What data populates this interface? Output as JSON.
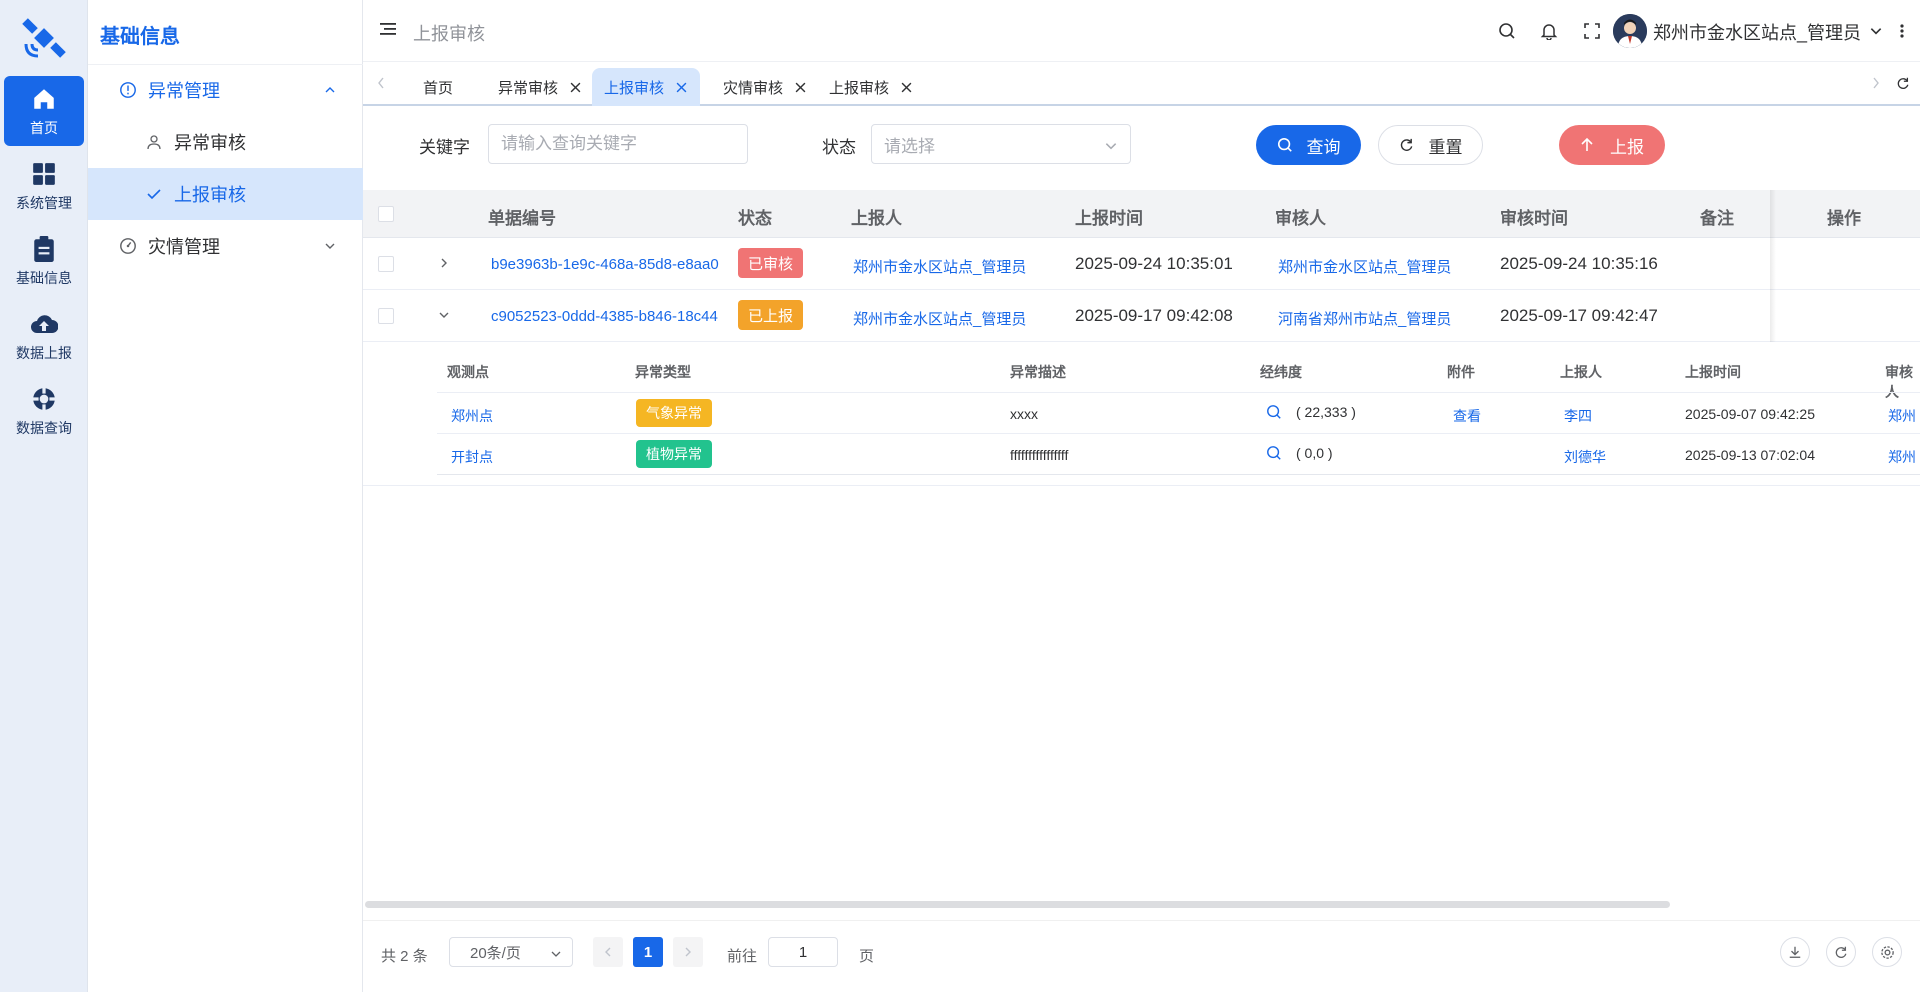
{
  "rail": {
    "items": [
      {
        "label": "首页",
        "icon": "home-icon"
      },
      {
        "label": "系统管理",
        "icon": "grid-icon"
      },
      {
        "label": "基础信息",
        "icon": "clipboard-icon"
      },
      {
        "label": "数据上报",
        "icon": "cloud-upload-icon"
      },
      {
        "label": "数据查询",
        "icon": "lifebuoy-icon"
      }
    ]
  },
  "submenu": {
    "title": "基础信息",
    "groups": [
      {
        "label": "异常管理",
        "icon": "info-circle-icon"
      },
      {
        "label": "灾情管理",
        "icon": "gauge-icon"
      }
    ],
    "children": [
      {
        "label": "异常审核",
        "icon": "user-icon"
      },
      {
        "label": "上报审核",
        "icon": "check-icon"
      }
    ]
  },
  "header": {
    "breadcrumb": "上报审核",
    "user_name": "郑州市金水区站点_管理员"
  },
  "tabs": [
    {
      "label": "首页"
    },
    {
      "label": "异常审核"
    },
    {
      "label": "上报审核"
    },
    {
      "label": "灾情审核"
    },
    {
      "label": "上报审核"
    }
  ],
  "search": {
    "keyword_label": "关键字",
    "keyword_placeholder": "请输入查询关键字",
    "status_label": "状态",
    "status_placeholder": "请选择",
    "query_button": "查询",
    "reset_button": "重置",
    "report_button": "上报"
  },
  "table": {
    "headers": [
      "单据编号",
      "状态",
      "上报人",
      "上报时间",
      "审核人",
      "审核时间",
      "备注",
      "操作"
    ],
    "rows": [
      {
        "id": "b9e3963b-1e9c-468a-85d8-e8aa0",
        "status": "已审核",
        "reporter": "郑州市金水区站点_管理员",
        "report_time": "2025-09-24 10:35:01",
        "reviewer": "郑州市金水区站点_管理员",
        "review_time": "2025-09-24 10:35:16"
      },
      {
        "id": "c9052523-0ddd-4385-b846-18c44",
        "status": "已上报",
        "reporter": "郑州市金水区站点_管理员",
        "report_time": "2025-09-17 09:42:08",
        "reviewer": "河南省郑州市站点_管理员",
        "review_time": "2025-09-17 09:42:47"
      }
    ],
    "status_colors": {
      "已审核": "#f07474",
      "已上报": "#f3a32a"
    }
  },
  "subtable": {
    "headers": [
      "观测点",
      "异常类型",
      "异常描述",
      "经纬度",
      "附件",
      "上报人",
      "上报时间",
      "审核人"
    ],
    "rows": [
      {
        "point": "郑州点",
        "type": "气象异常",
        "desc": "xxxx",
        "coords": "( 22,333 )",
        "attachment": "查看",
        "reporter": "李四",
        "time": "2025-09-07 09:42:25",
        "reviewer": "郑州"
      },
      {
        "point": "开封点",
        "type": "植物异常",
        "desc": "ffffffffffffffff",
        "coords": "( 0,0 )",
        "attachment": "",
        "reporter": "刘德华",
        "time": "2025-09-13 07:02:04",
        "reviewer": "郑州"
      }
    ],
    "type_colors": {
      "气象异常": "#f5b623",
      "植物异常": "#22c38e"
    }
  },
  "pagination": {
    "total": "共 2 条",
    "page_size": "20条/页",
    "current_page": "1",
    "goto_label": "前往",
    "goto_value": "1",
    "page_suffix": "页"
  },
  "colors": {
    "primary": "#1868e8",
    "danger": "#f07474"
  }
}
